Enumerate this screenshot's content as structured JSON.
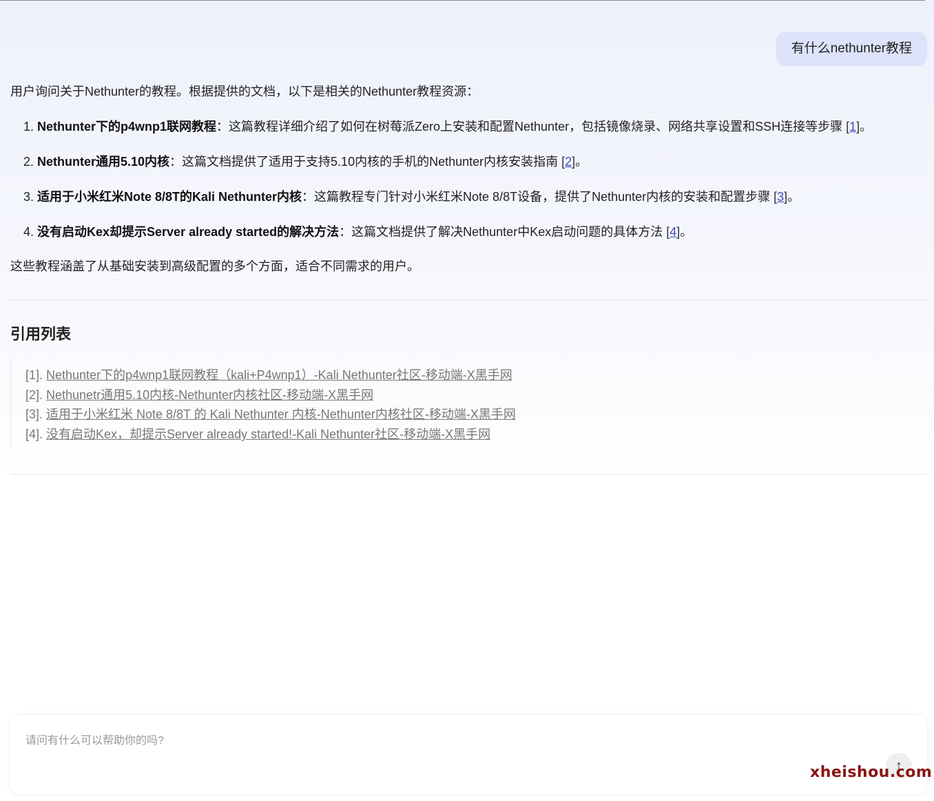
{
  "user_message": "有什么nethunter教程",
  "answer": {
    "intro": "用户询问关于Nethunter的教程。根据提供的文档，以下是相关的Nethunter教程资源：",
    "items": [
      {
        "num": "1.",
        "bold": "Nethunter下的p4wnp1联网教程",
        "sep": "：",
        "text": "这篇教程详细介绍了如何在树莓派Zero上安装和配置Nethunter，包括镜像烧录、网络共享设置和SSH连接等步骤 ",
        "cite_open": "[",
        "cite": "1",
        "cite_close": "]。"
      },
      {
        "num": "2.",
        "bold": "Nethunter通用5.10内核",
        "sep": "：",
        "text": "这篇文档提供了适用于支持5.10内核的手机的Nethunter内核安装指南 ",
        "cite_open": "[",
        "cite": "2",
        "cite_close": "]。"
      },
      {
        "num": "3.",
        "bold": "适用于小米红米Note 8/8T的Kali Nethunter内核",
        "sep": "：",
        "text": "这篇教程专门针对小米红米Note 8/8T设备，提供了Nethunter内核的安装和配置步骤 ",
        "cite_open": "[",
        "cite": "3",
        "cite_close": "]。"
      },
      {
        "num": "4.",
        "bold": "没有启动Kex却提示Server already started的解决方法",
        "sep": "：",
        "text": "这篇文档提供了解决Nethunter中Kex启动问题的具体方法 ",
        "cite_open": "[",
        "cite": "4",
        "cite_close": "]。"
      }
    ],
    "outro": "这些教程涵盖了从基础安装到高级配置的多个方面，适合不同需求的用户。"
  },
  "references": {
    "title": "引用列表",
    "items": [
      {
        "index": "[1]. ",
        "text": "Nethunter下的p4wnp1联网教程（kali+P4wnp1）-Kali Nethunter社区-移动端-X黑手网"
      },
      {
        "index": "[2]. ",
        "text": "Nethunetr通用5.10内核-Nethunter内核社区-移动端-X黑手网"
      },
      {
        "index": "[3]. ",
        "text": "适用于小米红米 Note 8/8T 的 Kali Nethunter 内核-Nethunter内核社区-移动端-X黑手网"
      },
      {
        "index": "[4]. ",
        "text": "没有启动Kex，却提示Server already started!-Kali Nethunter社区-移动端-X黑手网"
      }
    ]
  },
  "composer": {
    "placeholder": "请问有什么可以帮助你的吗?",
    "send_icon": "arrow-up-icon",
    "send_glyph": "↑"
  },
  "watermark": "xheishou.com",
  "colors": {
    "accent_link": "#3a4bbf",
    "bubble": "#dde3fb",
    "watermark": "#8b1414"
  }
}
